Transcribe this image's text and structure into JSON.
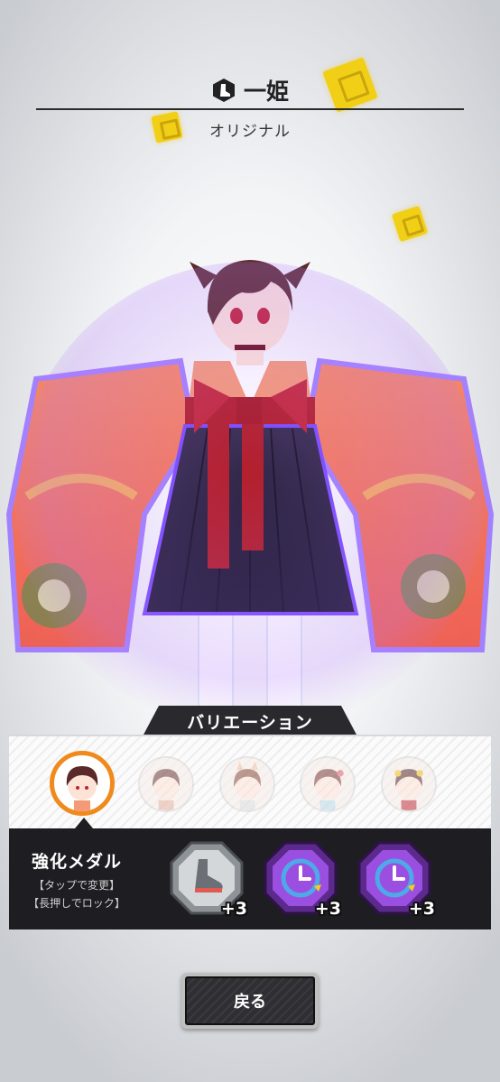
{
  "header": {
    "class_icon": "boot-icon",
    "character_name": "一姫",
    "variant_name": "オリジナル"
  },
  "variation": {
    "tab_label": "バリエーション",
    "items": [
      {
        "name": "original",
        "selected": true
      },
      {
        "name": "variant-2",
        "selected": false
      },
      {
        "name": "variant-3",
        "selected": false
      },
      {
        "name": "variant-4",
        "selected": false
      },
      {
        "name": "variant-5",
        "selected": false
      }
    ]
  },
  "medals": {
    "title": "強化メダル",
    "hint_tap": "【タップで変更】",
    "hint_hold": "【長押しでロック】",
    "items": [
      {
        "icon": "boot-medal-icon",
        "color": "#9ea3a8",
        "bonus": "+3"
      },
      {
        "icon": "clock-medal-icon",
        "color": "#8a3fd0",
        "bonus": "+3"
      },
      {
        "icon": "clock-medal-icon",
        "color": "#8a3fd0",
        "bonus": "+3"
      }
    ]
  },
  "buttons": {
    "back_label": "戻る"
  },
  "colors": {
    "accent": "#f08a1c",
    "panel": "#1e1e22",
    "gold": "#f2cf17",
    "purple": "#8a3fd0"
  }
}
